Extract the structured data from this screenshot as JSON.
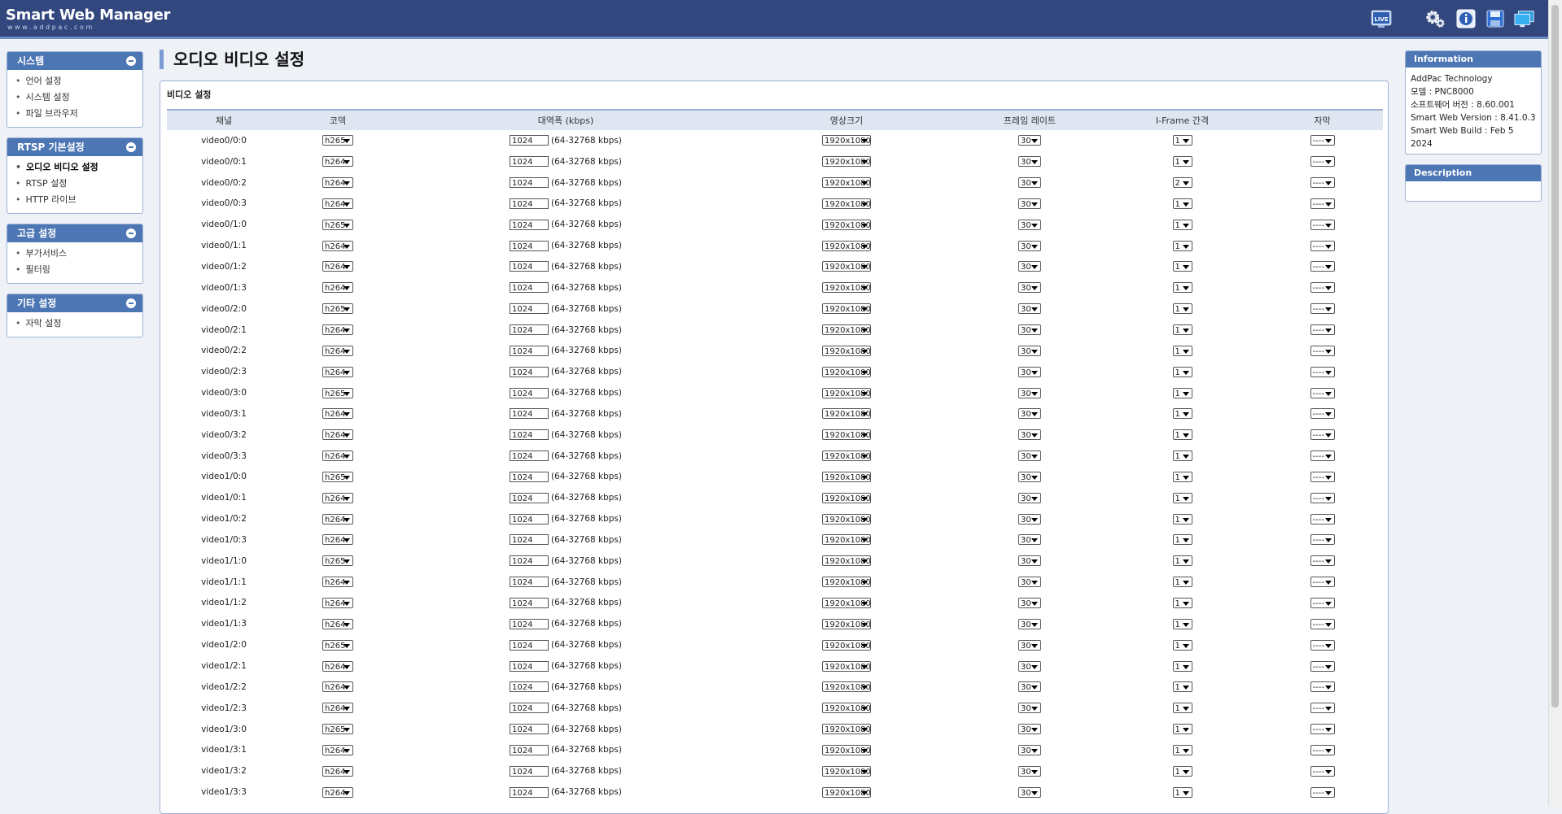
{
  "app": {
    "title": "Smart Web Manager",
    "subtitle": "www.addpac.com"
  },
  "header_icons": [
    {
      "name": "live-icon",
      "label": "LIVE"
    },
    {
      "name": "gear-icon"
    },
    {
      "name": "info-icon"
    },
    {
      "name": "save-icon"
    },
    {
      "name": "monitor-icon"
    }
  ],
  "sidebar": {
    "sections": [
      {
        "title": "시스템",
        "items": [
          "언어 설정",
          "시스템 설정",
          "파일 브라우저"
        ]
      },
      {
        "title": "RTSP 기본설정",
        "items": [
          "오디오 비디오 설정",
          "RTSP 설정",
          "HTTP 라이브"
        ]
      },
      {
        "title": "고급 설정",
        "items": [
          "부가서비스",
          "필터링"
        ]
      },
      {
        "title": "기타 설정",
        "items": [
          "자막 설정"
        ]
      }
    ],
    "active_item": "오디오 비디오 설정"
  },
  "page": {
    "title": "오디오 비디오 설정",
    "panel_title": "비디오 설정"
  },
  "table": {
    "headers": [
      "채널",
      "코덱",
      "대역폭 (kbps)",
      "영상크기",
      "프레임 레이트",
      "I-Frame 간격",
      "자막"
    ],
    "bandwidth_range": "(64-32768 kbps)",
    "rows": [
      {
        "channel": "video0/0:0",
        "codec": "h265",
        "bandwidth": "1024",
        "size": "1920x1080",
        "fps": "30",
        "iframe": "1",
        "subtitle": "----"
      },
      {
        "channel": "video0/0:1",
        "codec": "h264",
        "bandwidth": "1024",
        "size": "1920x1080",
        "fps": "30",
        "iframe": "1",
        "subtitle": "----"
      },
      {
        "channel": "video0/0:2",
        "codec": "h264",
        "bandwidth": "1024",
        "size": "1920x1080",
        "fps": "30",
        "iframe": "2",
        "subtitle": "----"
      },
      {
        "channel": "video0/0:3",
        "codec": "h264",
        "bandwidth": "1024",
        "size": "1920x1080",
        "fps": "30",
        "iframe": "1",
        "subtitle": "----"
      },
      {
        "channel": "video0/1:0",
        "codec": "h265",
        "bandwidth": "1024",
        "size": "1920x1080",
        "fps": "30",
        "iframe": "1",
        "subtitle": "----"
      },
      {
        "channel": "video0/1:1",
        "codec": "h264",
        "bandwidth": "1024",
        "size": "1920x1080",
        "fps": "30",
        "iframe": "1",
        "subtitle": "----"
      },
      {
        "channel": "video0/1:2",
        "codec": "h264",
        "bandwidth": "1024",
        "size": "1920x1080",
        "fps": "30",
        "iframe": "1",
        "subtitle": "----"
      },
      {
        "channel": "video0/1:3",
        "codec": "h264",
        "bandwidth": "1024",
        "size": "1920x1080",
        "fps": "30",
        "iframe": "1",
        "subtitle": "----"
      },
      {
        "channel": "video0/2:0",
        "codec": "h265",
        "bandwidth": "1024",
        "size": "1920x1080",
        "fps": "30",
        "iframe": "1",
        "subtitle": "----"
      },
      {
        "channel": "video0/2:1",
        "codec": "h264",
        "bandwidth": "1024",
        "size": "1920x1080",
        "fps": "30",
        "iframe": "1",
        "subtitle": "----"
      },
      {
        "channel": "video0/2:2",
        "codec": "h264",
        "bandwidth": "1024",
        "size": "1920x1080",
        "fps": "30",
        "iframe": "1",
        "subtitle": "----"
      },
      {
        "channel": "video0/2:3",
        "codec": "h264",
        "bandwidth": "1024",
        "size": "1920x1080",
        "fps": "30",
        "iframe": "1",
        "subtitle": "----"
      },
      {
        "channel": "video0/3:0",
        "codec": "h265",
        "bandwidth": "1024",
        "size": "1920x1080",
        "fps": "30",
        "iframe": "1",
        "subtitle": "----"
      },
      {
        "channel": "video0/3:1",
        "codec": "h264",
        "bandwidth": "1024",
        "size": "1920x1080",
        "fps": "30",
        "iframe": "1",
        "subtitle": "----"
      },
      {
        "channel": "video0/3:2",
        "codec": "h264",
        "bandwidth": "1024",
        "size": "1920x1080",
        "fps": "30",
        "iframe": "1",
        "subtitle": "----"
      },
      {
        "channel": "video0/3:3",
        "codec": "h264",
        "bandwidth": "1024",
        "size": "1920x1080",
        "fps": "30",
        "iframe": "1",
        "subtitle": "----"
      },
      {
        "channel": "video1/0:0",
        "codec": "h265",
        "bandwidth": "1024",
        "size": "1920x1080",
        "fps": "30",
        "iframe": "1",
        "subtitle": "----"
      },
      {
        "channel": "video1/0:1",
        "codec": "h264",
        "bandwidth": "1024",
        "size": "1920x1080",
        "fps": "30",
        "iframe": "1",
        "subtitle": "----"
      },
      {
        "channel": "video1/0:2",
        "codec": "h264",
        "bandwidth": "1024",
        "size": "1920x1080",
        "fps": "30",
        "iframe": "1",
        "subtitle": "----"
      },
      {
        "channel": "video1/0:3",
        "codec": "h264",
        "bandwidth": "1024",
        "size": "1920x1080",
        "fps": "30",
        "iframe": "1",
        "subtitle": "----"
      },
      {
        "channel": "video1/1:0",
        "codec": "h265",
        "bandwidth": "1024",
        "size": "1920x1080",
        "fps": "30",
        "iframe": "1",
        "subtitle": "----"
      },
      {
        "channel": "video1/1:1",
        "codec": "h264",
        "bandwidth": "1024",
        "size": "1920x1080",
        "fps": "30",
        "iframe": "1",
        "subtitle": "----"
      },
      {
        "channel": "video1/1:2",
        "codec": "h264",
        "bandwidth": "1024",
        "size": "1920x1080",
        "fps": "30",
        "iframe": "1",
        "subtitle": "----"
      },
      {
        "channel": "video1/1:3",
        "codec": "h264",
        "bandwidth": "1024",
        "size": "1920x1080",
        "fps": "30",
        "iframe": "1",
        "subtitle": "----"
      },
      {
        "channel": "video1/2:0",
        "codec": "h265",
        "bandwidth": "1024",
        "size": "1920x1080",
        "fps": "30",
        "iframe": "1",
        "subtitle": "----"
      },
      {
        "channel": "video1/2:1",
        "codec": "h264",
        "bandwidth": "1024",
        "size": "1920x1080",
        "fps": "30",
        "iframe": "1",
        "subtitle": "----"
      },
      {
        "channel": "video1/2:2",
        "codec": "h264",
        "bandwidth": "1024",
        "size": "1920x1080",
        "fps": "30",
        "iframe": "1",
        "subtitle": "----"
      },
      {
        "channel": "video1/2:3",
        "codec": "h264",
        "bandwidth": "1024",
        "size": "1920x1080",
        "fps": "30",
        "iframe": "1",
        "subtitle": "----"
      },
      {
        "channel": "video1/3:0",
        "codec": "h265",
        "bandwidth": "1024",
        "size": "1920x1080",
        "fps": "30",
        "iframe": "1",
        "subtitle": "----"
      },
      {
        "channel": "video1/3:1",
        "codec": "h264",
        "bandwidth": "1024",
        "size": "1920x1080",
        "fps": "30",
        "iframe": "1",
        "subtitle": "----"
      },
      {
        "channel": "video1/3:2",
        "codec": "h264",
        "bandwidth": "1024",
        "size": "1920x1080",
        "fps": "30",
        "iframe": "1",
        "subtitle": "----"
      },
      {
        "channel": "video1/3:3",
        "codec": "h264",
        "bandwidth": "1024",
        "size": "1920x1080",
        "fps": "30",
        "iframe": "1",
        "subtitle": "----"
      }
    ]
  },
  "info": {
    "title": "Information",
    "lines": [
      "AddPac Technology",
      "모델 : PNC8000",
      "소프트웨어 버전 : 8.60.001",
      "Smart Web Version : 8.41.0.3",
      "Smart Web Build : Feb 5 2024"
    ]
  },
  "description": {
    "title": "Description"
  },
  "colors": {
    "header": "#33477f",
    "section_header": "#4d76b4",
    "accent": "#7a9bd3"
  }
}
